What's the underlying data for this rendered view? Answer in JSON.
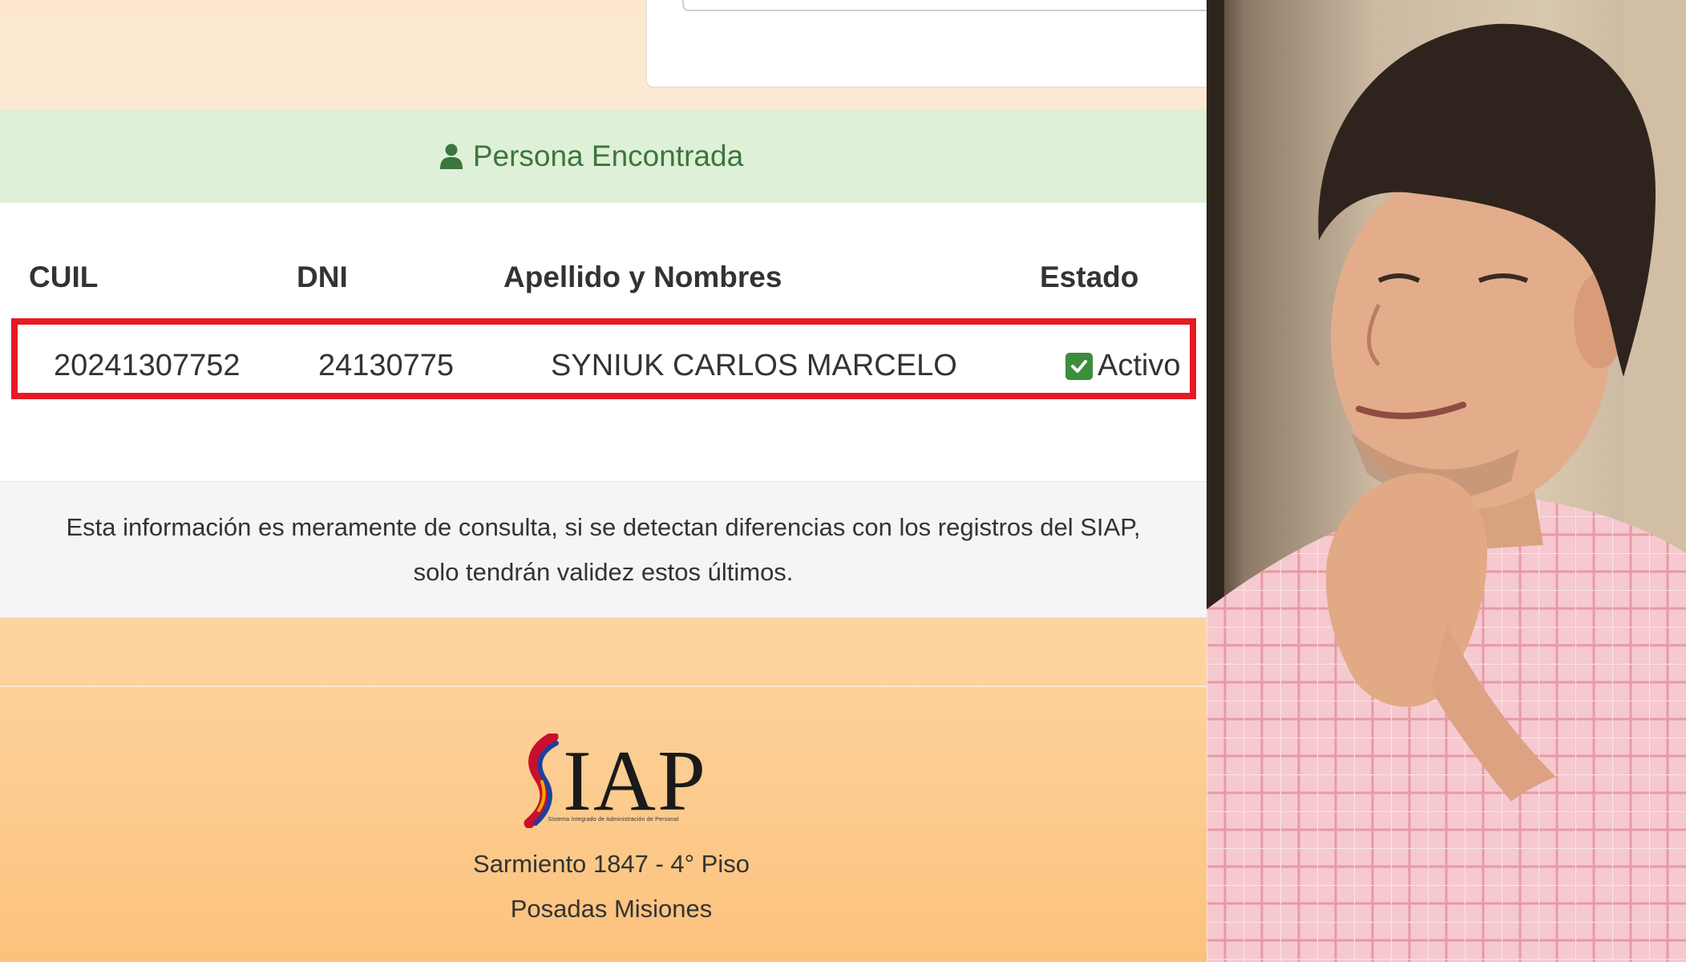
{
  "result_banner": {
    "icon": "user-icon",
    "text": "Persona Encontrada"
  },
  "table": {
    "headers": [
      "CUIL",
      "DNI",
      "Apellido y Nombres",
      "Estado"
    ],
    "row": {
      "cuil": "20241307752",
      "dni": "24130775",
      "nombre": "SYNIUK CARLOS MARCELO",
      "estado": "Activo",
      "estado_icon": "check-square-icon"
    },
    "highlight_color": "#e51b24"
  },
  "disclaimer": {
    "line1": "Esta información es meramente de consulta, si se detectan diferencias con los registros del SIAP,",
    "line2": "solo tendrán validez estos últimos."
  },
  "footer": {
    "logo_text": "IAP",
    "logo_subtitle": "Sistema Integrado de Administración de Personal",
    "address_line1": "Sarmiento 1847 - 4° Piso",
    "address_line2": "Posadas Misiones"
  },
  "colors": {
    "success_bg": "#dff0d8",
    "success_text": "#3c763d",
    "footer_bg": "#fcc27c"
  }
}
